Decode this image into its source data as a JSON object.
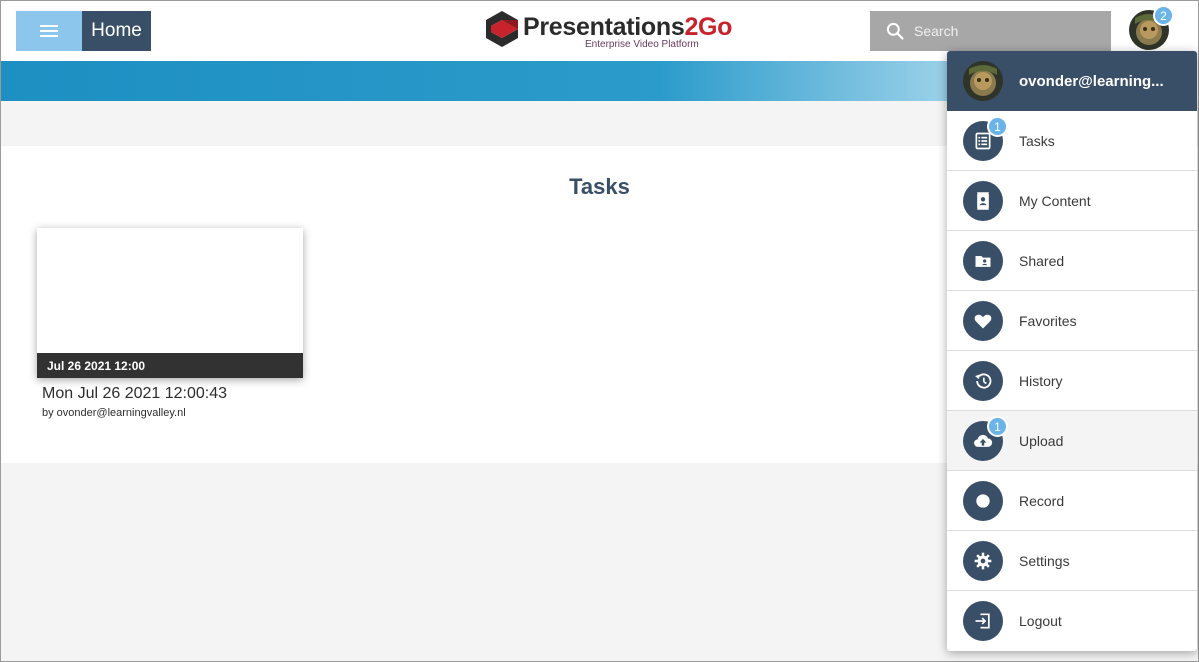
{
  "header": {
    "home_label": "Home",
    "logo_text_main": "Presentations",
    "logo_text_accent": "2Go",
    "logo_subtitle": "Enterprise Video Platform",
    "search_placeholder": "Search",
    "notification_count": "2"
  },
  "main": {
    "title": "Tasks",
    "card": {
      "date_label": "Jul 26 2021 12:00",
      "title": "Mon Jul 26 2021 12:00:43",
      "byline": "by ovonder@learningvalley.nl"
    }
  },
  "dropdown": {
    "user": "ovonder@learning...",
    "items": [
      {
        "label": "Tasks",
        "icon": "tasks-list-icon",
        "badge": "1"
      },
      {
        "label": "My Content",
        "icon": "contact-card-icon",
        "badge": ""
      },
      {
        "label": "Shared",
        "icon": "shared-folder-icon",
        "badge": ""
      },
      {
        "label": "Favorites",
        "icon": "heart-icon",
        "badge": ""
      },
      {
        "label": "History",
        "icon": "history-icon",
        "badge": ""
      },
      {
        "label": "Upload",
        "icon": "cloud-upload-icon",
        "badge": "1"
      },
      {
        "label": "Record",
        "icon": "record-icon",
        "badge": ""
      },
      {
        "label": "Settings",
        "icon": "gear-icon",
        "badge": ""
      },
      {
        "label": "Logout",
        "icon": "logout-icon",
        "badge": ""
      }
    ]
  },
  "colors": {
    "navy": "#394f67",
    "light_blue": "#8cc6ec",
    "badge_blue": "#6ab4e8",
    "banner_blue": "#1e8fc2",
    "logo_red": "#c8232c"
  }
}
